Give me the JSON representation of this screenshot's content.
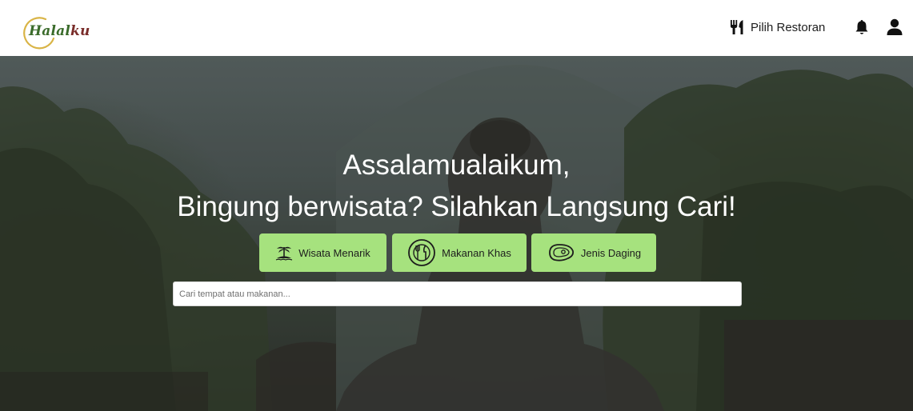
{
  "brand": {
    "logo_text": "Halal",
    "logo_text_tail": "ku"
  },
  "nav": {
    "restaurant_label": "Pilih Restoran"
  },
  "hero": {
    "greeting": "Assalamualaikum,",
    "subtitle": "Bingung berwisata? Silahkan Langsung Cari!"
  },
  "categories": [
    {
      "label": "Wisata Menarik",
      "icon": "island-icon"
    },
    {
      "label": "Makanan Khas",
      "icon": "plate-cutlery-icon"
    },
    {
      "label": "Jenis Daging",
      "icon": "meat-icon"
    }
  ],
  "search": {
    "placeholder": "Cari tempat atau makanan...",
    "value": ""
  },
  "colors": {
    "button_bg": "#a6e27e",
    "logo_green": "#3a6b2a",
    "logo_red": "#7a2d2a",
    "logo_ring": "#d9b446"
  }
}
